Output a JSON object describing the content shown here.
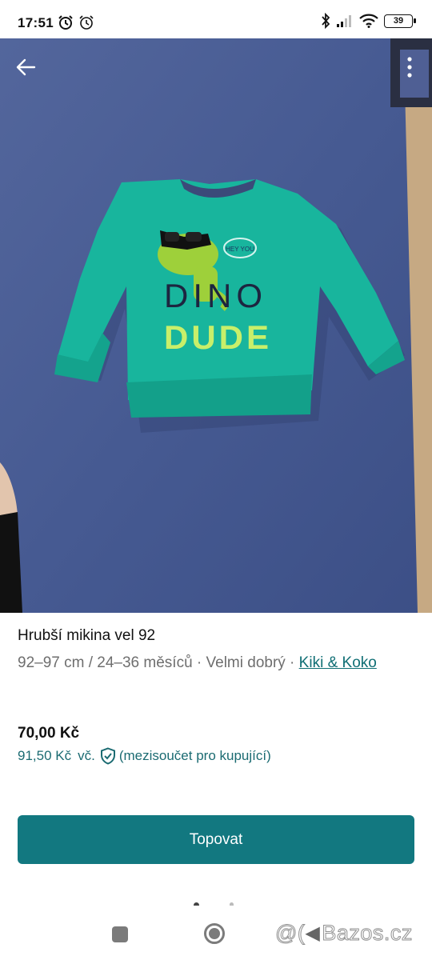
{
  "status_bar": {
    "time": "17:51",
    "battery": "39",
    "icons": [
      "alarm-icon",
      "alarm-icon",
      "bluetooth-icon",
      "signal-icon",
      "wifi-icon",
      "battery-icon"
    ]
  },
  "photo": {
    "description_icon": "sweatshirt-photo",
    "print_text_top": "DINO",
    "print_text_bottom": "DUDE",
    "bubble_text": "HEY YOU"
  },
  "listing": {
    "title": "Hrubší mikina vel 92",
    "meta": "92–97 cm / 24–36 měsíců · Velmi dobrý · ",
    "brand": "Kiki & Koko",
    "price": "70,00 Kč",
    "buyer_price": "91,50 Kč",
    "buyer_price_suffix": "vč.",
    "buyer_price_note": "(mezisoučet pro kupující)"
  },
  "actions": {
    "bump_label": "Topovat"
  },
  "watermark": {
    "text": "Bazos.cz"
  },
  "colors": {
    "accent": "#127880",
    "link": "#0f6e74",
    "sweater": "#16b49c",
    "background_blanket": "#4a5d95"
  }
}
